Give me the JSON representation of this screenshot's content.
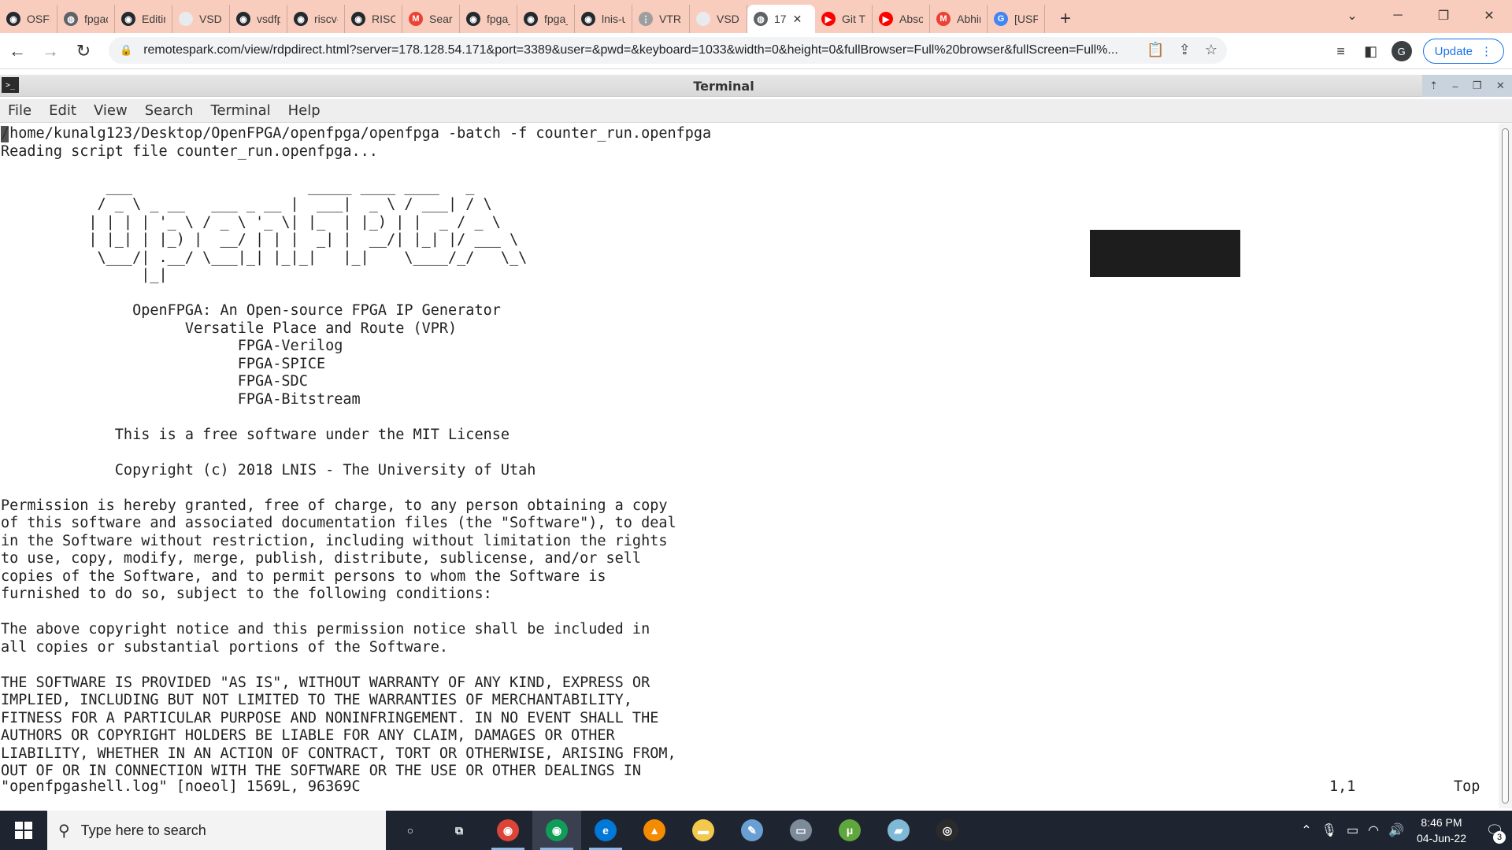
{
  "browser": {
    "tabs": [
      {
        "label": "OSFP",
        "icon": "github-icon",
        "color": "#24292e",
        "glyph": "◉"
      },
      {
        "label": "fpgac",
        "icon": "globe-icon",
        "color": "#5f6368",
        "glyph": "◍"
      },
      {
        "label": "Editin",
        "icon": "github-icon",
        "color": "#24292e",
        "glyph": "◉"
      },
      {
        "label": "VSDIA",
        "icon": "page-icon",
        "color": "#e8eaed",
        "glyph": ""
      },
      {
        "label": "vsdfp",
        "icon": "github-icon",
        "color": "#24292e",
        "glyph": "◉"
      },
      {
        "label": "riscv-",
        "icon": "github-icon",
        "color": "#24292e",
        "glyph": "◉"
      },
      {
        "label": "RISC-",
        "icon": "github-icon",
        "color": "#24292e",
        "glyph": "◉"
      },
      {
        "label": "Searc",
        "icon": "gmail-icon",
        "color": "#ea4335",
        "glyph": "M"
      },
      {
        "label": "fpga_",
        "icon": "github-icon",
        "color": "#24292e",
        "glyph": "◉"
      },
      {
        "label": "fpga_",
        "icon": "github-icon",
        "color": "#24292e",
        "glyph": "◉"
      },
      {
        "label": "lnis-u",
        "icon": "github-icon",
        "color": "#24292e",
        "glyph": "◉"
      },
      {
        "label": "VTR C",
        "icon": "grid-icon",
        "color": "#9e9e9e",
        "glyph": "⋮"
      },
      {
        "label": "VSDIA",
        "icon": "page-icon",
        "color": "#e8eaed",
        "glyph": ""
      },
      {
        "label": "17",
        "icon": "globe-icon",
        "color": "#5f6368",
        "glyph": "◍",
        "active": true
      },
      {
        "label": "Git Tu",
        "icon": "youtube-icon",
        "color": "#ff0000",
        "glyph": "▶"
      },
      {
        "label": "Absol",
        "icon": "youtube-icon",
        "color": "#ff0000",
        "glyph": "▶"
      },
      {
        "label": "Abhir",
        "icon": "gmail-icon",
        "color": "#ea4335",
        "glyph": "M"
      },
      {
        "label": "[USF-",
        "icon": "google-icon",
        "color": "#4285f4",
        "glyph": "G"
      }
    ],
    "url": "remotespark.com/view/rdpdirect.html?server=178.128.54.171&port=3389&user=&pwd=&keyboard=1033&width=0&height=0&fullBrowser=Full%20browser&fullScreen=Full%...",
    "profile_initial": "G",
    "update_label": "Update"
  },
  "terminal": {
    "title": "Terminal",
    "menu": [
      "File",
      "Edit",
      "View",
      "Search",
      "Terminal",
      "Help"
    ],
    "lines": [
      "/home/kunalg123/Desktop/OpenFPGA/openfpga/openfpga -batch -f counter_run.openfpga",
      "Reading script file counter_run.openfpga...",
      "",
      "            ___                    _____ ____ ____   _",
      "           / _ \\ _ __   ___ _ __ |  ___|  _ \\ / ___| / \\",
      "          | | | | '_ \\ / _ \\ '_ \\| |_  | |_) | |  _ / _ \\",
      "          | |_| | |_) |  __/ | | |  _| |  __/| |_| |/ ___ \\",
      "           \\___/| .__/ \\___|_| |_|_|   |_|    \\____/_/   \\_\\",
      "                |_|",
      "",
      "               OpenFPGA: An Open-source FPGA IP Generator",
      "                     Versatile Place and Route (VPR)",
      "                           FPGA-Verilog",
      "                           FPGA-SPICE",
      "                           FPGA-SDC",
      "                           FPGA-Bitstream",
      "",
      "             This is a free software under the MIT License",
      "",
      "             Copyright (c) 2018 LNIS - The University of Utah",
      "",
      "Permission is hereby granted, free of charge, to any person obtaining a copy",
      "of this software and associated documentation files (the \"Software\"), to deal",
      "in the Software without restriction, including without limitation the rights",
      "to use, copy, modify, merge, publish, distribute, sublicense, and/or sell",
      "copies of the Software, and to permit persons to whom the Software is",
      "furnished to do so, subject to the following conditions:",
      "",
      "The above copyright notice and this permission notice shall be included in",
      "all copies or substantial portions of the Software.",
      "",
      "THE SOFTWARE IS PROVIDED \"AS IS\", WITHOUT WARRANTY OF ANY KIND, EXPRESS OR",
      "IMPLIED, INCLUDING BUT NOT LIMITED TO THE WARRANTIES OF MERCHANTABILITY,",
      "FITNESS FOR A PARTICULAR PURPOSE AND NONINFRINGEMENT. IN NO EVENT SHALL THE",
      "AUTHORS OR COPYRIGHT HOLDERS BE LIABLE FOR ANY CLAIM, DAMAGES OR OTHER",
      "LIABILITY, WHETHER IN AN ACTION OF CONTRACT, TORT OR OTHERWISE, ARISING FROM,",
      "OUT OF OR IN CONNECTION WITH THE SOFTWARE OR THE USE OR OTHER DEALINGS IN"
    ],
    "status_file": "\"openfpgashell.log\" [noeol] 1569L, 96369C",
    "status_position": "1,1",
    "status_scroll": "Top"
  },
  "taskbar": {
    "search_placeholder": "Type here to search",
    "apps": [
      {
        "name": "cortana-icon",
        "glyph": "○",
        "color": "transparent"
      },
      {
        "name": "task-view-icon",
        "glyph": "⧉",
        "color": "transparent"
      },
      {
        "name": "chrome-icon",
        "glyph": "◉",
        "color": "#db4437",
        "running": true
      },
      {
        "name": "chrome-profile-icon",
        "glyph": "◉",
        "color": "#0f9d58",
        "running": true,
        "active": true
      },
      {
        "name": "edge-icon",
        "glyph": "e",
        "color": "#0078d7",
        "running": true
      },
      {
        "name": "vlc-icon",
        "glyph": "▲",
        "color": "#f48b00"
      },
      {
        "name": "file-explorer-icon",
        "glyph": "▬",
        "color": "#f2c94c"
      },
      {
        "name": "paint-icon",
        "glyph": "✎",
        "color": "#6a9fd4"
      },
      {
        "name": "remote-desktop-icon",
        "glyph": "▭",
        "color": "#7c8a99"
      },
      {
        "name": "utorrent-icon",
        "glyph": "μ",
        "color": "#5fa73d"
      },
      {
        "name": "notes-app-icon",
        "glyph": "▰",
        "color": "#7fb9d6"
      },
      {
        "name": "obs-icon",
        "glyph": "◎",
        "color": "#2b2b2b"
      }
    ],
    "time": "8:46 PM",
    "date": "04-Jun-22",
    "notification_count": "3"
  }
}
